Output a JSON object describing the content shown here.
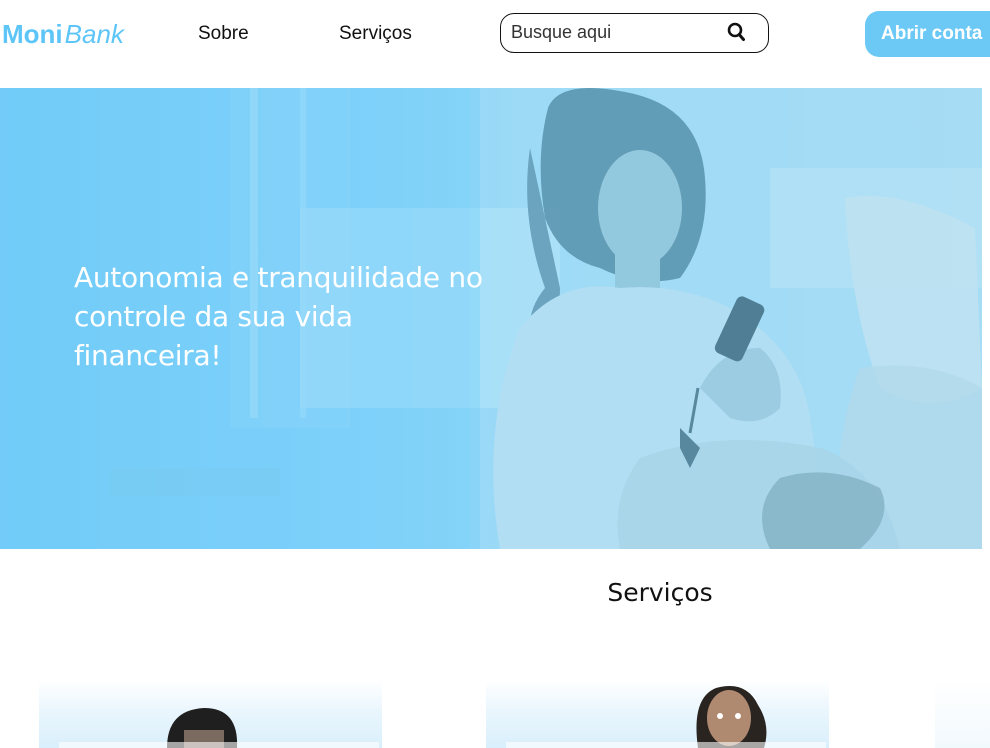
{
  "brand": {
    "name_strong": "Moni",
    "name_light": "Bank",
    "accent_color": "#5dc5f7"
  },
  "nav": {
    "items": [
      {
        "label": "Sobre"
      },
      {
        "label": "Serviços"
      }
    ]
  },
  "search": {
    "placeholder": "Busque aqui",
    "value": "",
    "icon": "search-icon"
  },
  "cta": {
    "label": "Abrir conta",
    "color": "#6cc9f6"
  },
  "hero": {
    "title": "Autonomia e tranquilidade no controle da sua vida financeira!",
    "text_color": "#ffffff",
    "overlay_color": "#6fcaf8"
  },
  "services": {
    "title": "Serviços"
  }
}
